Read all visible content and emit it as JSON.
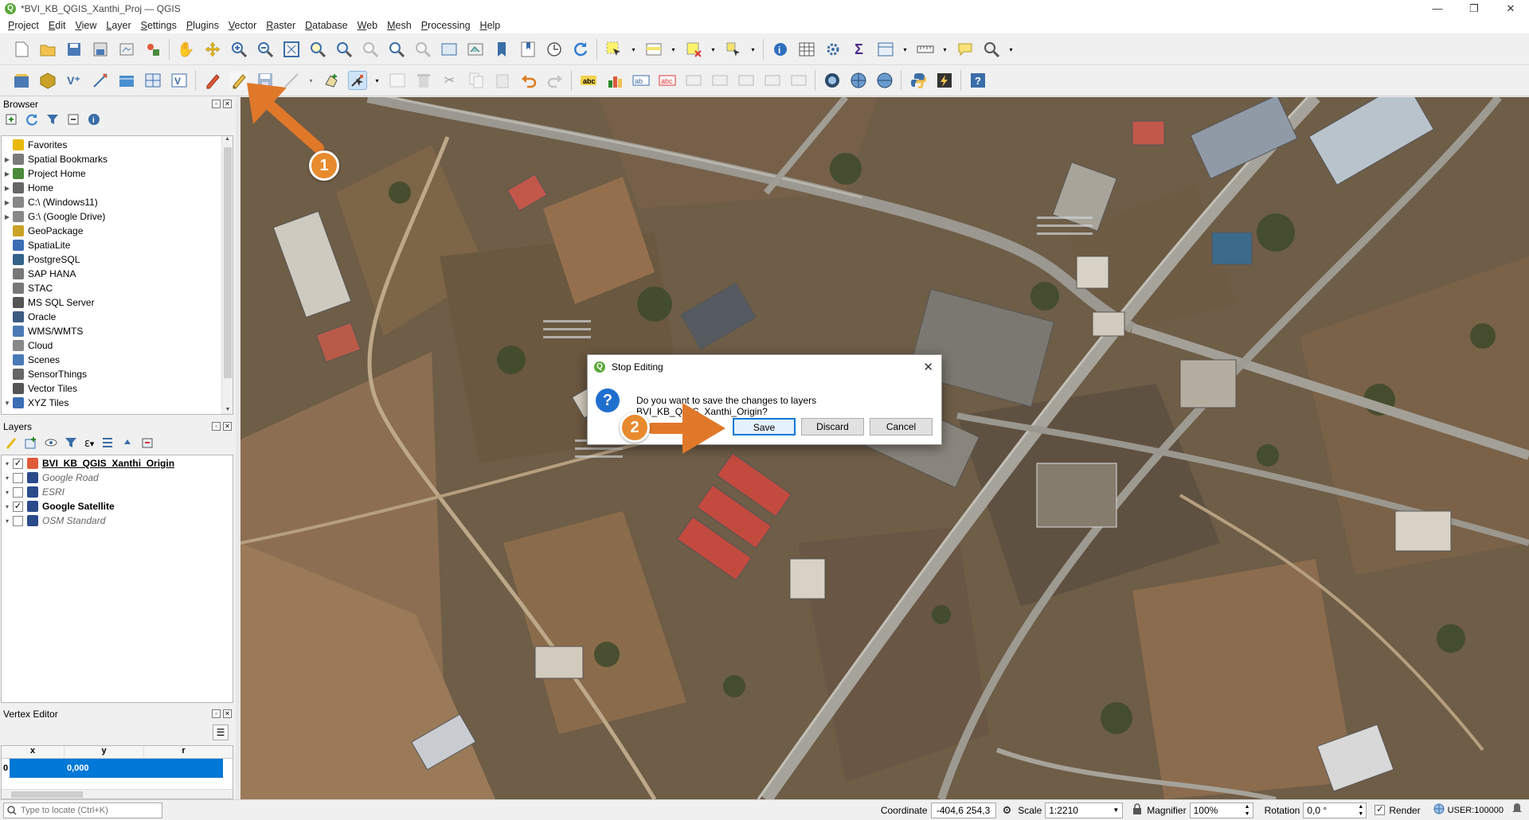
{
  "window": {
    "title": "*BVI_KB_QGIS_Xanthi_Proj — QGIS",
    "min": "—",
    "max": "❐",
    "close": "✕"
  },
  "menu": [
    "Project",
    "Edit",
    "View",
    "Layer",
    "Settings",
    "Plugins",
    "Vector",
    "Raster",
    "Database",
    "Web",
    "Mesh",
    "Processing",
    "Help"
  ],
  "browser": {
    "title": "Browser",
    "items": [
      {
        "label": "Favorites",
        "icon": "star-icon",
        "color": "#e8b90c",
        "expand": ""
      },
      {
        "label": "Spatial Bookmarks",
        "icon": "bookmark-icon",
        "color": "#7a7a7a",
        "expand": "▶"
      },
      {
        "label": "Project Home",
        "icon": "project-home-icon",
        "color": "#4a8a3a",
        "expand": "▶"
      },
      {
        "label": "Home",
        "icon": "home-icon",
        "color": "#666",
        "expand": "▶"
      },
      {
        "label": "C:\\ (Windows11)",
        "icon": "folder-icon",
        "color": "#888",
        "expand": "▶"
      },
      {
        "label": "G:\\ (Google Drive)",
        "icon": "folder-icon",
        "color": "#888",
        "expand": "▶"
      },
      {
        "label": "GeoPackage",
        "icon": "geopackage-icon",
        "color": "#c9a227",
        "expand": ""
      },
      {
        "label": "SpatiaLite",
        "icon": "spatialite-icon",
        "color": "#3b6db3",
        "expand": ""
      },
      {
        "label": "PostgreSQL",
        "icon": "postgresql-icon",
        "color": "#33628a",
        "expand": ""
      },
      {
        "label": "SAP HANA",
        "icon": "sap-hana-icon",
        "color": "#777",
        "expand": ""
      },
      {
        "label": "STAC",
        "icon": "stac-icon",
        "color": "#777",
        "expand": ""
      },
      {
        "label": "MS SQL Server",
        "icon": "mssql-icon",
        "color": "#555",
        "expand": ""
      },
      {
        "label": "Oracle",
        "icon": "oracle-icon",
        "color": "#3c5a80",
        "expand": ""
      },
      {
        "label": "WMS/WMTS",
        "icon": "wms-icon",
        "color": "#4a7ab5",
        "expand": ""
      },
      {
        "label": "Cloud",
        "icon": "cloud-icon",
        "color": "#888",
        "expand": ""
      },
      {
        "label": "Scenes",
        "icon": "scenes-icon",
        "color": "#4a7ab5",
        "expand": ""
      },
      {
        "label": "SensorThings",
        "icon": "sensorthings-icon",
        "color": "#666",
        "expand": ""
      },
      {
        "label": "Vector Tiles",
        "icon": "vector-tiles-icon",
        "color": "#555",
        "expand": ""
      },
      {
        "label": "XYZ Tiles",
        "icon": "xyz-tiles-icon",
        "color": "#3b6db3",
        "expand": "▼"
      }
    ]
  },
  "layers": {
    "title": "Layers",
    "items": [
      {
        "label": "BVI_KB_QGIS_Xanthi_Origin",
        "checked": "✓",
        "style": "bold-underline",
        "icon": "polygon-layer-icon"
      },
      {
        "label": "Google Road",
        "checked": "",
        "style": "italic-gray",
        "icon": "raster-layer-icon"
      },
      {
        "label": "ESRI",
        "checked": "",
        "style": "italic-gray",
        "icon": "raster-layer-icon"
      },
      {
        "label": "Google Satellite",
        "checked": "✓",
        "style": "bold",
        "icon": "raster-layer-icon"
      },
      {
        "label": "OSM Standard",
        "checked": "",
        "style": "italic-gray",
        "icon": "raster-layer-icon"
      }
    ]
  },
  "vertex_editor": {
    "title": "Vertex Editor",
    "columns": [
      "x",
      "y",
      "r"
    ],
    "row_index": "0",
    "row_values": [
      "",
      "0,000",
      ""
    ]
  },
  "dialog": {
    "title": "Stop Editing",
    "message": "Do you want to save the changes to layers BVI_KB_QGIS_Xanthi_Origin?",
    "buttons": {
      "save": "Save",
      "discard": "Discard",
      "cancel": "Cancel"
    }
  },
  "annotations": {
    "step1": "1",
    "step2": "2"
  },
  "statusbar": {
    "locate_placeholder": "Type to locate (Ctrl+K)",
    "coordinate_label": "Coordinate",
    "coordinate_value": "-404,6  254,3",
    "scale_label": "Scale",
    "scale_value": "1:2210",
    "magnifier_label": "Magnifier",
    "magnifier_value": "100%",
    "rotation_label": "Rotation",
    "rotation_value": "0,0 °",
    "render_label": "Render",
    "crs_label": "USER:100000"
  },
  "colors": {
    "accent": "#0078d7",
    "badge": "#e88a2e",
    "arrow": "#e0782a"
  }
}
